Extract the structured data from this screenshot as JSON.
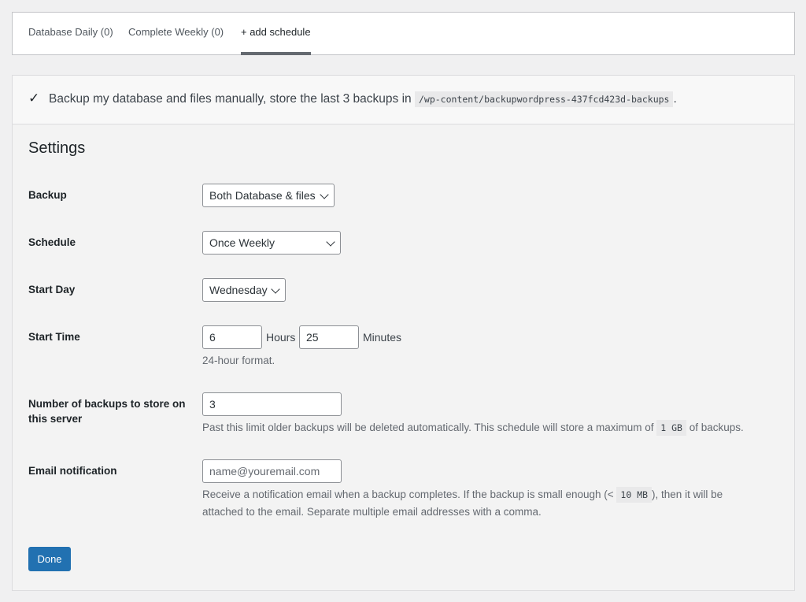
{
  "tabs": [
    {
      "label": "Database Daily (0)"
    },
    {
      "label": "Complete Weekly (0)"
    },
    {
      "label": "+ add schedule"
    }
  ],
  "summary": {
    "check": "✓",
    "text_before": "Backup my database and files manually, store the last 3 backups in ",
    "path": "/wp-content/backupwordpress-437fcd423d-backups",
    "text_after": "."
  },
  "settings": {
    "title": "Settings",
    "backup": {
      "label": "Backup",
      "value": "Both Database & files"
    },
    "schedule": {
      "label": "Schedule",
      "value": "Once Weekly"
    },
    "start_day": {
      "label": "Start Day",
      "value": "Wednesday"
    },
    "start_time": {
      "label": "Start Time",
      "hours": "6",
      "hours_unit": "Hours",
      "minutes": "25",
      "minutes_unit": "Minutes",
      "help": "24-hour format."
    },
    "max_backups": {
      "label": "Number of backups to store on this server",
      "value": "3",
      "help_before": "Past this limit older backups will be deleted automatically. This schedule will store a maximum of ",
      "help_size": "1 GB",
      "help_after": " of backups."
    },
    "email": {
      "label": "Email notification",
      "placeholder": "name@youremail.com",
      "help_line1_before": "Receive a notification email when a backup completes. If the backup is small enough (< ",
      "help_size": "10 MB",
      "help_line1_after": "), then it will be",
      "help_line2": "attached to the email. Separate multiple email addresses with a comma."
    },
    "done_label": "Done"
  },
  "colors": {
    "primary_button": "#2271b1",
    "background": "#f0f0f1",
    "active_tab_indicator": "#646970"
  }
}
